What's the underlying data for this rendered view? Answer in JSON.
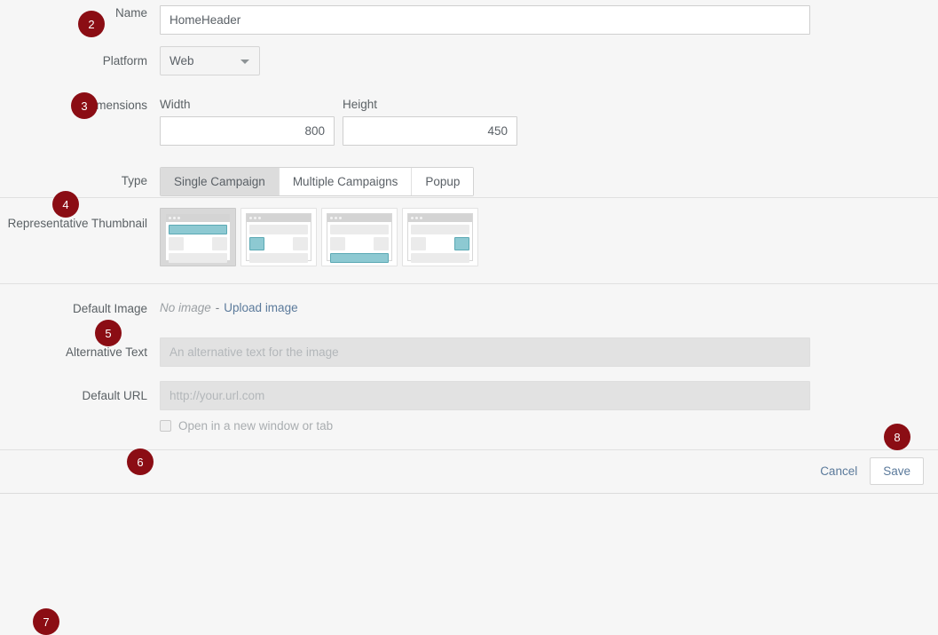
{
  "form": {
    "name": {
      "badge": "2",
      "label": "Name",
      "value": "HomeHeader"
    },
    "platform": {
      "badge": "3",
      "label": "Platform",
      "selected": "Web",
      "options": [
        "Web"
      ]
    },
    "dimensions": {
      "badge": "4",
      "label": "Dimensions",
      "width_label": "Width",
      "width_value": "800",
      "height_label": "Height",
      "height_value": "450"
    },
    "type": {
      "badge": "5",
      "label": "Type",
      "options": [
        {
          "label": "Single Campaign",
          "active": true
        },
        {
          "label": "Multiple Campaigns",
          "active": false
        },
        {
          "label": "Popup",
          "active": false
        }
      ]
    },
    "thumbnail": {
      "badge": "6",
      "label": "Representative Thumbnail",
      "items": [
        {
          "name": "thumbnail-top-banner",
          "highlight": "top",
          "selected": true
        },
        {
          "name": "thumbnail-left-block",
          "highlight": "left",
          "selected": false
        },
        {
          "name": "thumbnail-bottom-banner",
          "highlight": "bottom",
          "selected": false
        },
        {
          "name": "thumbnail-right-block",
          "highlight": "right",
          "selected": false
        }
      ]
    },
    "default_image": {
      "badge": "7",
      "label": "Default Image",
      "no_image_text": "No image",
      "separator": "-",
      "upload_link": "Upload image"
    },
    "alt_text": {
      "label": "Alternative Text",
      "placeholder": "An alternative text for the image",
      "value": ""
    },
    "default_url": {
      "label": "Default URL",
      "placeholder": "http://your.url.com",
      "value": ""
    },
    "new_window": {
      "label": "Open in a new window or tab",
      "checked": false
    }
  },
  "footer": {
    "badge": "8",
    "cancel_label": "Cancel",
    "save_label": "Save"
  },
  "colors": {
    "badge_bg": "#8b0d14",
    "accent_teal": "#8dc9d2",
    "link": "#5b7a9b",
    "page_bg": "#f6f6f6"
  }
}
